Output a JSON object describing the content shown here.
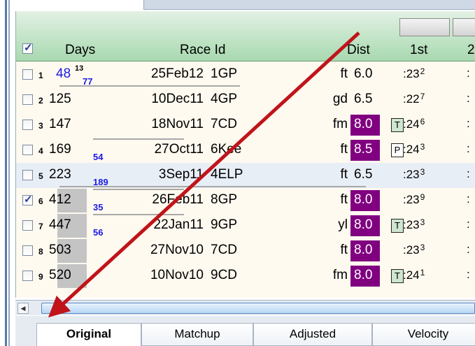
{
  "header": {
    "select_all_checked": true,
    "columns": {
      "days": "Days",
      "race_id": "Race Id",
      "dist": "Dist",
      "first": "1st",
      "second": "2"
    }
  },
  "rows": [
    {
      "num": "1",
      "checked": false,
      "days": "48",
      "days_blue": true,
      "days_sup": "13",
      "days_sub": "77",
      "date": "25Feb12",
      "race": "1GP",
      "surface": "ft",
      "dist": "6.0",
      "dist_purple": false,
      "tag": "",
      "first": ":23",
      "first_sup": "2"
    },
    {
      "num": "2",
      "checked": false,
      "days": "125",
      "date": "10Dec11",
      "race": "4GP",
      "surface": "gd",
      "dist": "6.5",
      "dist_purple": false,
      "tag": "",
      "first": ":22",
      "first_sup": "7"
    },
    {
      "num": "3",
      "checked": false,
      "days": "147",
      "date": "18Nov11",
      "race": "7CD",
      "surface": "fm",
      "dist": "8.0",
      "dist_purple": true,
      "tag": "T",
      "first": ":24",
      "first_sup": "6"
    },
    {
      "num": "4",
      "checked": false,
      "days": "169",
      "days_sub": "54",
      "date": "27Oct11",
      "race": "6Kee",
      "surface": "ft",
      "dist": "8.5",
      "dist_purple": true,
      "tag": "P",
      "first": ":24",
      "first_sup": "3"
    },
    {
      "num": "5",
      "checked": false,
      "days": "223",
      "days_sub": "189",
      "date": "3Sep11",
      "race": "4ELP",
      "surface": "ft",
      "dist": "6.5",
      "dist_purple": false,
      "tag": "",
      "first": ":23",
      "first_sup": "3",
      "selected": true
    },
    {
      "num": "6",
      "checked": true,
      "days": "412",
      "days_sub": "35",
      "date": "26Feb11",
      "race": "8GP",
      "surface": "ft",
      "dist": "8.0",
      "dist_purple": true,
      "tag": "",
      "first": ":23",
      "first_sup": "9",
      "grey": true
    },
    {
      "num": "7",
      "checked": false,
      "days": "447",
      "days_sub": "56",
      "date": "22Jan11",
      "race": "9GP",
      "surface": "yl",
      "dist": "8.0",
      "dist_purple": true,
      "tag": "T",
      "first": ":23",
      "first_sup": "3",
      "grey": true
    },
    {
      "num": "8",
      "checked": false,
      "days": "503",
      "date": "27Nov10",
      "race": "7CD",
      "surface": "ft",
      "dist": "8.0",
      "dist_purple": true,
      "tag": "",
      "first": ":23",
      "first_sup": "3",
      "grey": true
    },
    {
      "num": "9",
      "checked": false,
      "days": "520",
      "date": "10Nov10",
      "race": "9CD",
      "surface": "fm",
      "dist": "8.0",
      "dist_purple": true,
      "tag": "T",
      "first": ":24",
      "first_sup": "1",
      "grey": true
    }
  ],
  "colors": {
    "purple": "#800080",
    "blue": "#1a1ae6",
    "arrow": "#c0141a",
    "header_green": "#bfe3c4"
  },
  "tabs": [
    "Original",
    "Matchup",
    "Adjusted",
    "Velocity"
  ],
  "active_tab": "Original",
  "icons": [
    "checkbox-icon",
    "scroll-left-arrow-icon",
    "annotation-arrow-icon"
  ]
}
